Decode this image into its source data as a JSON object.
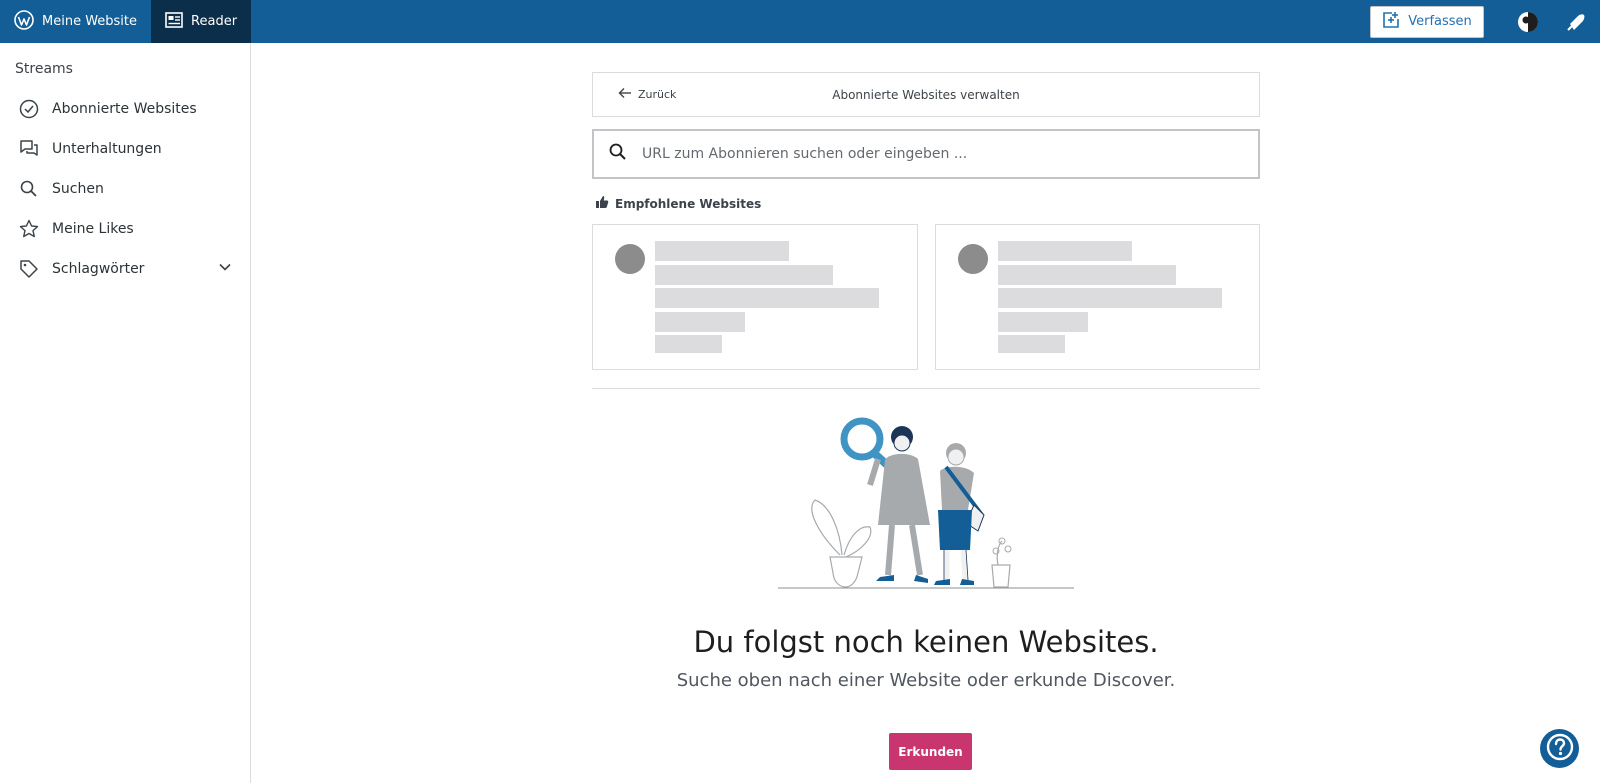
{
  "masterbar": {
    "my_site": "Meine Website",
    "reader": "Reader",
    "write": "Verfassen"
  },
  "sidebar": {
    "heading": "Streams",
    "items": [
      {
        "label": "Abonnierte Websites",
        "icon": "check-circle-icon"
      },
      {
        "label": "Unterhaltungen",
        "icon": "conversations-icon"
      },
      {
        "label": "Suchen",
        "icon": "search-icon"
      },
      {
        "label": "Meine Likes",
        "icon": "star-icon"
      },
      {
        "label": "Schlagwörter",
        "icon": "tag-icon"
      }
    ]
  },
  "header": {
    "back": "Zurück",
    "title": "Abonnierte Websites verwalten"
  },
  "search": {
    "placeholder": "URL zum Abonnieren suchen oder eingeben ..."
  },
  "recommended": {
    "heading": "Empfohlene Websites"
  },
  "empty": {
    "title": "Du folgst noch keinen Websites.",
    "subtitle": "Suche oben nach einer Website oder erkunde Discover.",
    "button": "Erkunden"
  },
  "colors": {
    "masterbar": "#135e96",
    "active_tab": "#0b2e4a",
    "accent_pink": "#c9356e",
    "illustration_blue": "#3f94c3"
  }
}
